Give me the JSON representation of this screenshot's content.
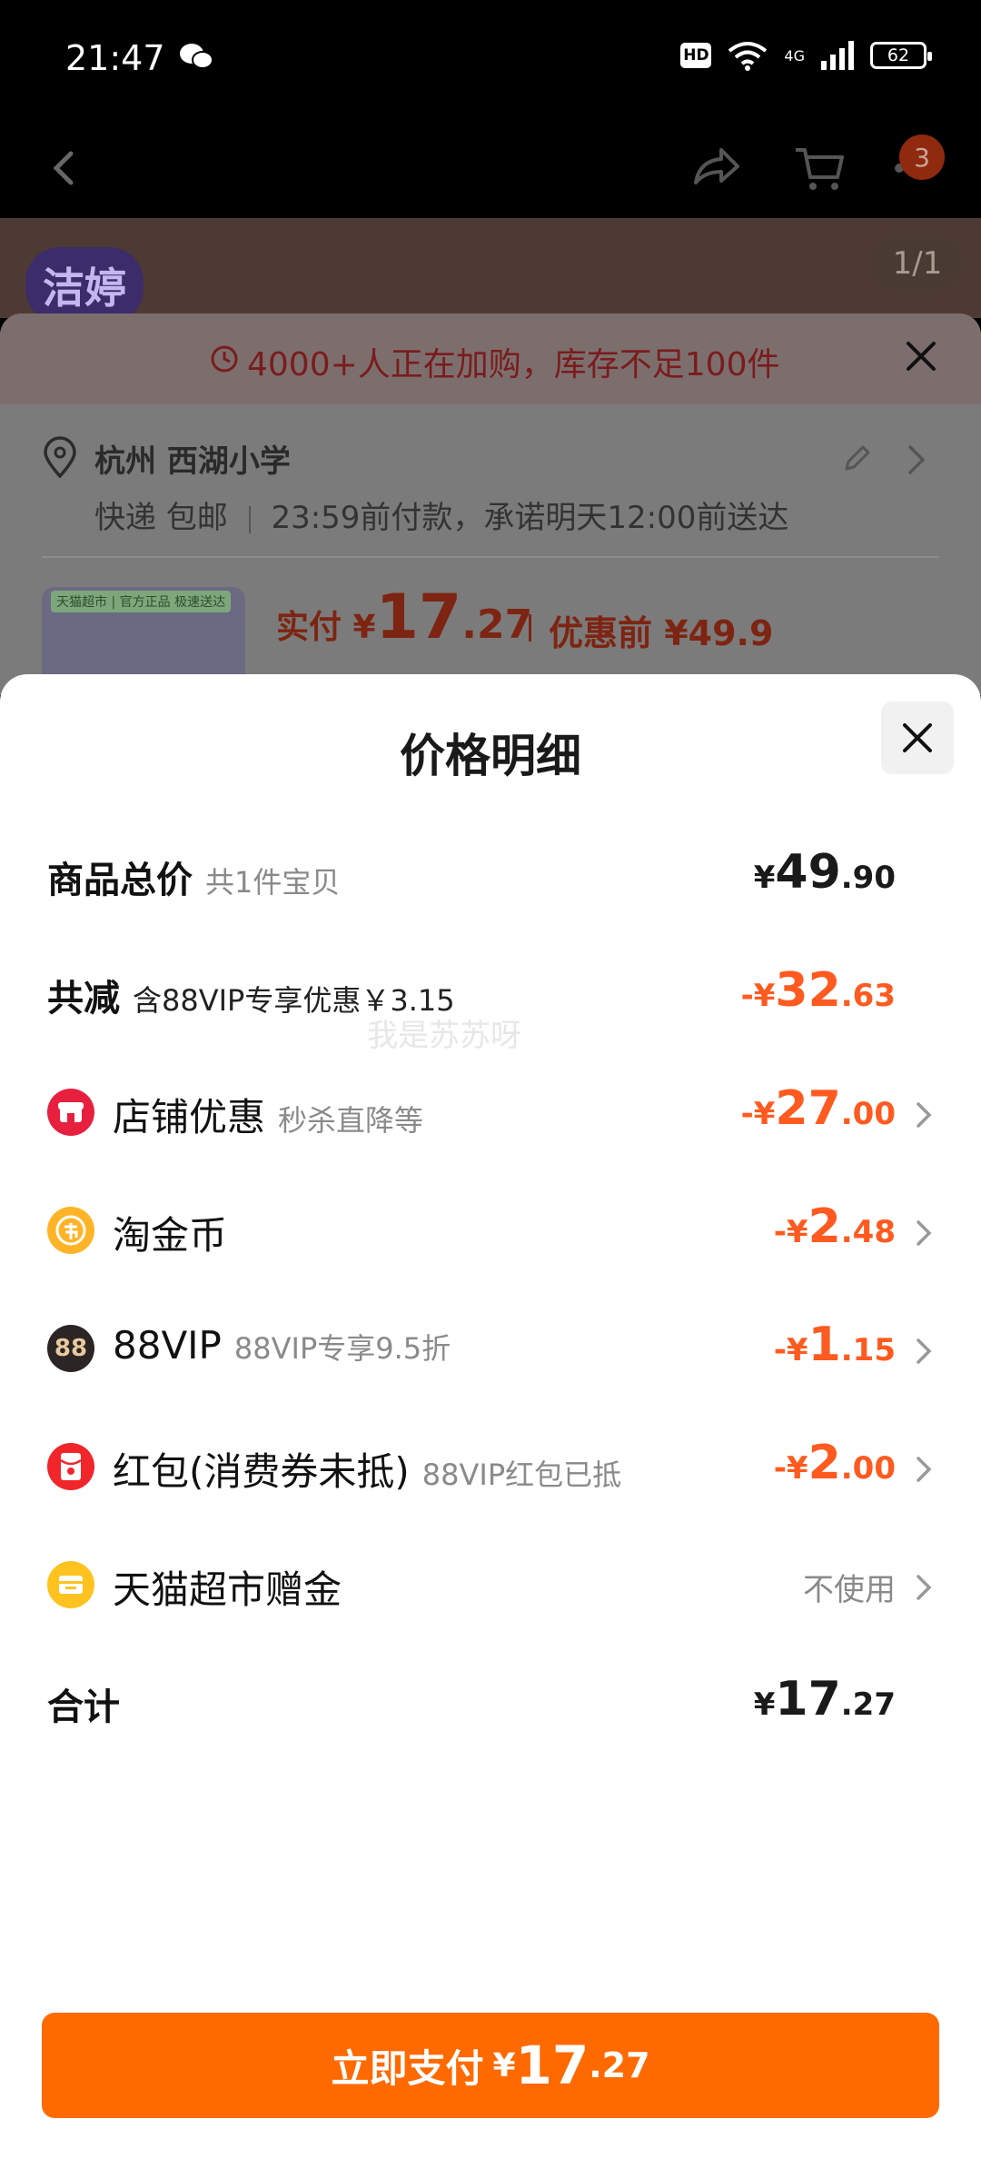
{
  "status_bar": {
    "time": "21:47",
    "hd": "HD",
    "network": "4G",
    "battery": "62"
  },
  "nav": {
    "cart_badge": "3"
  },
  "product_hero": {
    "brand": "洁婷",
    "image_counter": "1/1"
  },
  "order_card": {
    "stock_banner": "4000+人正在加购，库存不足100件",
    "address_title": "杭州 西湖小学",
    "delivery_method": "快递 包邮",
    "delivery_promise": "23:59前付款，承诺明天12:00前送达",
    "thumb_tag": "天猫超市 | 官方正品 极速送达",
    "paid_label": "实付 ¥",
    "paid_int": "17",
    "paid_dec": ".27",
    "original_price": "优惠前 ¥49.9"
  },
  "price_detail": {
    "title": "价格明细",
    "subtotal": {
      "label": "商品总价",
      "sub": "共1件宝贝",
      "sym": "¥",
      "int": "49",
      "dec": ".90"
    },
    "total_reduction": {
      "label": "共减",
      "sub": "含88VIP专享优惠￥3.15",
      "sym": "-¥",
      "int": "32",
      "dec": ".63"
    },
    "items": [
      {
        "label": "店铺优惠",
        "sub": "秒杀直降等",
        "sym": "-¥",
        "int": "27",
        "dec": ".00",
        "icon": "shop-icon"
      },
      {
        "label": "淘金币",
        "sub": "",
        "sym": "-¥",
        "int": "2",
        "dec": ".48",
        "icon": "coin-icon"
      },
      {
        "label": "88VIP",
        "sub": "88VIP专享9.5折",
        "sym": "-¥",
        "int": "1",
        "dec": ".15",
        "icon": "vip-icon"
      },
      {
        "label": "红包(消费券未抵)",
        "sub": "88VIP红包已抵",
        "sym": "-¥",
        "int": "2",
        "dec": ".00",
        "icon": "red-packet-icon"
      }
    ],
    "tmall_gift": {
      "label": "天猫超市赠金",
      "value": "不使用"
    },
    "total": {
      "label": "合计",
      "sym": "¥",
      "int": "17",
      "dec": ".27"
    }
  },
  "watermark": "我是苏苏呀",
  "pay_button": {
    "label": "立即支付",
    "sym": "¥",
    "int": "17",
    "dec": ".27"
  },
  "colors": {
    "accent": "#ff6a00",
    "discount": "#ff5a1f",
    "text": "#1a1a1a",
    "muted": "#8a8a8a"
  }
}
